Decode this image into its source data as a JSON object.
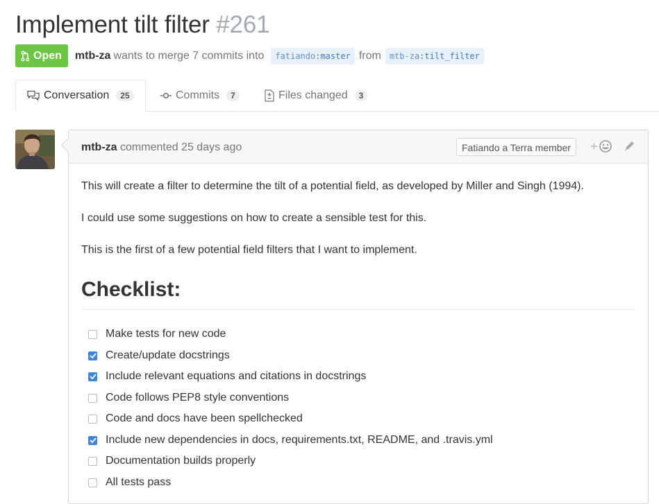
{
  "pr": {
    "title": "Implement tilt filter",
    "number": "#261",
    "state": "Open",
    "author": "mtb-za",
    "merge_text": "wants to merge 7 commits into",
    "base_user": "fatiando",
    "base_ref": "master",
    "from_text": "from",
    "head_user": "mtb-za",
    "head_ref": "tilt_filter"
  },
  "tabs": [
    {
      "label": "Conversation",
      "count": "25"
    },
    {
      "label": "Commits",
      "count": "7"
    },
    {
      "label": "Files changed",
      "count": "3"
    }
  ],
  "comment": {
    "author": "mtb-za",
    "action": "commented 25 days ago",
    "role": "Fatiando a Terra member",
    "paragraphs": [
      "This will create a filter to determine the tilt of a potential field, as developed by Miller and Singh (1994).",
      "I could use some suggestions on how to create a sensible test for this.",
      "This is the first of a few potential field filters that I want to implement."
    ],
    "checklist_heading": "Checklist:",
    "tasks": [
      {
        "label": "Make tests for new code",
        "checked": false
      },
      {
        "label": "Create/update docstrings",
        "checked": true
      },
      {
        "label": "Include relevant equations and citations in docstrings",
        "checked": true
      },
      {
        "label": "Code follows PEP8 style conventions",
        "checked": false
      },
      {
        "label": "Code and docs have been spellchecked",
        "checked": false
      },
      {
        "label": "Include new dependencies in docs, requirements.txt, README, and .travis.yml",
        "checked": true
      },
      {
        "label": "Documentation builds properly",
        "checked": false
      },
      {
        "label": "All tests pass",
        "checked": false
      }
    ]
  },
  "colors": {
    "open_green": "#6cc644",
    "checkbox_blue": "#3d85d6",
    "branch_bg": "#e8f1fa"
  },
  "icons": {
    "state": "git-pull-request-icon",
    "conversation": "comment-discussion-icon",
    "commits": "git-commit-icon",
    "files": "diff-icon",
    "reaction": "add-reaction-icon",
    "edit": "pencil-icon"
  }
}
